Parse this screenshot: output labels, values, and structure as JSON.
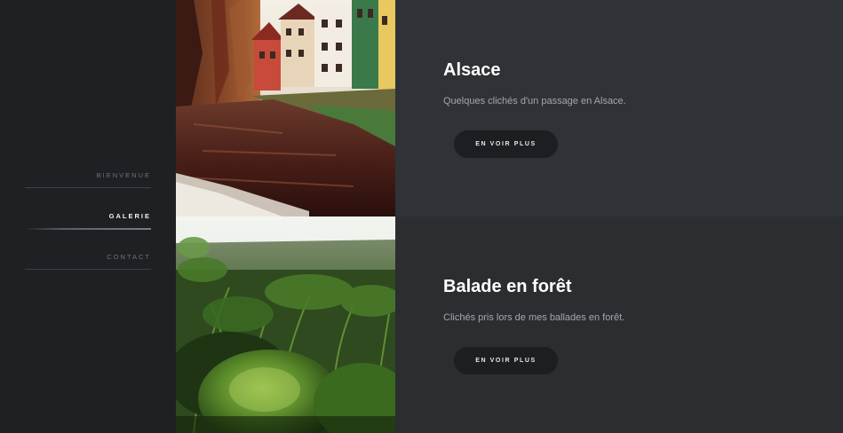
{
  "nav": {
    "items": [
      {
        "label": "BIENVENUE"
      },
      {
        "label": "GALERIE"
      },
      {
        "label": "CONTACT"
      }
    ],
    "active_index": 1
  },
  "albums": [
    {
      "title": "Alsace",
      "description": "Quelques clichés d'un passage en Alsace.",
      "button_label": "EN VOIR PLUS",
      "image": "alsace-canal-houses-photo"
    },
    {
      "title": "Balade en forêt",
      "description": "Clichés pris lors de mes ballades en forêt.",
      "button_label": "EN VOIR PLUS",
      "image": "forest-moss-photo"
    }
  ],
  "colors": {
    "sidebar_bg": "#1e2124",
    "row1_bg": "#2f3236",
    "row2_bg": "#2b2d31",
    "button_bg": "#1c1e21",
    "title": "#ffffff",
    "description": "#a3a7ab",
    "nav_inactive": "#6d7176",
    "nav_active": "#f2f2f2"
  }
}
